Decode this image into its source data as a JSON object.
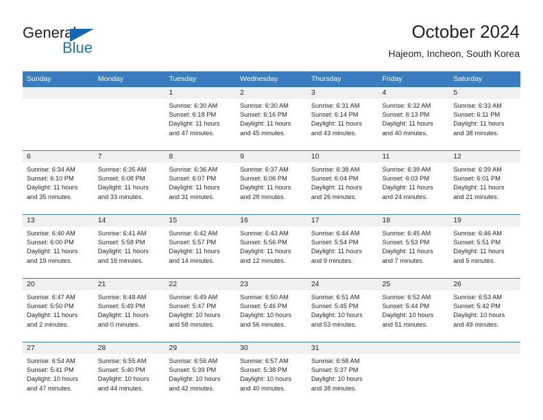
{
  "brand": {
    "name_primary": "General",
    "name_secondary": "Blue",
    "triangle_color": "#1268b3",
    "secondary_color": "#1b75bc"
  },
  "header": {
    "title": "October 2024",
    "subtitle": "Hajeom, Incheon, South Korea"
  },
  "theme": {
    "header_blue": "#3a7cc0",
    "daynum_band": "#f0f0f0",
    "text": "#231f20"
  },
  "weekdays": [
    "Sunday",
    "Monday",
    "Tuesday",
    "Wednesday",
    "Thursday",
    "Friday",
    "Saturday"
  ],
  "weeks": [
    [
      {
        "day": "",
        "sunrise": "",
        "sunset": "",
        "daylight_line1": "",
        "daylight_line2": "",
        "empty": true
      },
      {
        "day": "",
        "sunrise": "",
        "sunset": "",
        "daylight_line1": "",
        "daylight_line2": "",
        "empty": true
      },
      {
        "day": "1",
        "sunrise": "Sunrise: 6:30 AM",
        "sunset": "Sunset: 6:18 PM",
        "daylight_line1": "Daylight: 11 hours",
        "daylight_line2": "and 47 minutes."
      },
      {
        "day": "2",
        "sunrise": "Sunrise: 6:30 AM",
        "sunset": "Sunset: 6:16 PM",
        "daylight_line1": "Daylight: 11 hours",
        "daylight_line2": "and 45 minutes."
      },
      {
        "day": "3",
        "sunrise": "Sunrise: 6:31 AM",
        "sunset": "Sunset: 6:14 PM",
        "daylight_line1": "Daylight: 11 hours",
        "daylight_line2": "and 43 minutes."
      },
      {
        "day": "4",
        "sunrise": "Sunrise: 6:32 AM",
        "sunset": "Sunset: 6:13 PM",
        "daylight_line1": "Daylight: 11 hours",
        "daylight_line2": "and 40 minutes."
      },
      {
        "day": "5",
        "sunrise": "Sunrise: 6:33 AM",
        "sunset": "Sunset: 6:11 PM",
        "daylight_line1": "Daylight: 11 hours",
        "daylight_line2": "and 38 minutes."
      }
    ],
    [
      {
        "day": "6",
        "sunrise": "Sunrise: 6:34 AM",
        "sunset": "Sunset: 6:10 PM",
        "daylight_line1": "Daylight: 11 hours",
        "daylight_line2": "and 35 minutes."
      },
      {
        "day": "7",
        "sunrise": "Sunrise: 6:35 AM",
        "sunset": "Sunset: 6:08 PM",
        "daylight_line1": "Daylight: 11 hours",
        "daylight_line2": "and 33 minutes."
      },
      {
        "day": "8",
        "sunrise": "Sunrise: 6:36 AM",
        "sunset": "Sunset: 6:07 PM",
        "daylight_line1": "Daylight: 11 hours",
        "daylight_line2": "and 31 minutes."
      },
      {
        "day": "9",
        "sunrise": "Sunrise: 6:37 AM",
        "sunset": "Sunset: 6:06 PM",
        "daylight_line1": "Daylight: 11 hours",
        "daylight_line2": "and 28 minutes."
      },
      {
        "day": "10",
        "sunrise": "Sunrise: 6:38 AM",
        "sunset": "Sunset: 6:04 PM",
        "daylight_line1": "Daylight: 11 hours",
        "daylight_line2": "and 26 minutes."
      },
      {
        "day": "11",
        "sunrise": "Sunrise: 6:39 AM",
        "sunset": "Sunset: 6:03 PM",
        "daylight_line1": "Daylight: 11 hours",
        "daylight_line2": "and 24 minutes."
      },
      {
        "day": "12",
        "sunrise": "Sunrise: 6:39 AM",
        "sunset": "Sunset: 6:01 PM",
        "daylight_line1": "Daylight: 11 hours",
        "daylight_line2": "and 21 minutes."
      }
    ],
    [
      {
        "day": "13",
        "sunrise": "Sunrise: 6:40 AM",
        "sunset": "Sunset: 6:00 PM",
        "daylight_line1": "Daylight: 11 hours",
        "daylight_line2": "and 19 minutes."
      },
      {
        "day": "14",
        "sunrise": "Sunrise: 6:41 AM",
        "sunset": "Sunset: 5:58 PM",
        "daylight_line1": "Daylight: 11 hours",
        "daylight_line2": "and 16 minutes."
      },
      {
        "day": "15",
        "sunrise": "Sunrise: 6:42 AM",
        "sunset": "Sunset: 5:57 PM",
        "daylight_line1": "Daylight: 11 hours",
        "daylight_line2": "and 14 minutes."
      },
      {
        "day": "16",
        "sunrise": "Sunrise: 6:43 AM",
        "sunset": "Sunset: 5:56 PM",
        "daylight_line1": "Daylight: 11 hours",
        "daylight_line2": "and 12 minutes."
      },
      {
        "day": "17",
        "sunrise": "Sunrise: 6:44 AM",
        "sunset": "Sunset: 5:54 PM",
        "daylight_line1": "Daylight: 11 hours",
        "daylight_line2": "and 9 minutes."
      },
      {
        "day": "18",
        "sunrise": "Sunrise: 6:45 AM",
        "sunset": "Sunset: 5:53 PM",
        "daylight_line1": "Daylight: 11 hours",
        "daylight_line2": "and 7 minutes."
      },
      {
        "day": "19",
        "sunrise": "Sunrise: 6:46 AM",
        "sunset": "Sunset: 5:51 PM",
        "daylight_line1": "Daylight: 11 hours",
        "daylight_line2": "and 5 minutes."
      }
    ],
    [
      {
        "day": "20",
        "sunrise": "Sunrise: 6:47 AM",
        "sunset": "Sunset: 5:50 PM",
        "daylight_line1": "Daylight: 11 hours",
        "daylight_line2": "and 2 minutes."
      },
      {
        "day": "21",
        "sunrise": "Sunrise: 6:48 AM",
        "sunset": "Sunset: 5:49 PM",
        "daylight_line1": "Daylight: 11 hours",
        "daylight_line2": "and 0 minutes."
      },
      {
        "day": "22",
        "sunrise": "Sunrise: 6:49 AM",
        "sunset": "Sunset: 5:47 PM",
        "daylight_line1": "Daylight: 10 hours",
        "daylight_line2": "and 58 minutes."
      },
      {
        "day": "23",
        "sunrise": "Sunrise: 6:50 AM",
        "sunset": "Sunset: 5:46 PM",
        "daylight_line1": "Daylight: 10 hours",
        "daylight_line2": "and 56 minutes."
      },
      {
        "day": "24",
        "sunrise": "Sunrise: 6:51 AM",
        "sunset": "Sunset: 5:45 PM",
        "daylight_line1": "Daylight: 10 hours",
        "daylight_line2": "and 53 minutes."
      },
      {
        "day": "25",
        "sunrise": "Sunrise: 6:52 AM",
        "sunset": "Sunset: 5:44 PM",
        "daylight_line1": "Daylight: 10 hours",
        "daylight_line2": "and 51 minutes."
      },
      {
        "day": "26",
        "sunrise": "Sunrise: 6:53 AM",
        "sunset": "Sunset: 5:42 PM",
        "daylight_line1": "Daylight: 10 hours",
        "daylight_line2": "and 49 minutes."
      }
    ],
    [
      {
        "day": "27",
        "sunrise": "Sunrise: 6:54 AM",
        "sunset": "Sunset: 5:41 PM",
        "daylight_line1": "Daylight: 10 hours",
        "daylight_line2": "and 47 minutes."
      },
      {
        "day": "28",
        "sunrise": "Sunrise: 6:55 AM",
        "sunset": "Sunset: 5:40 PM",
        "daylight_line1": "Daylight: 10 hours",
        "daylight_line2": "and 44 minutes."
      },
      {
        "day": "29",
        "sunrise": "Sunrise: 6:56 AM",
        "sunset": "Sunset: 5:39 PM",
        "daylight_line1": "Daylight: 10 hours",
        "daylight_line2": "and 42 minutes."
      },
      {
        "day": "30",
        "sunrise": "Sunrise: 6:57 AM",
        "sunset": "Sunset: 5:38 PM",
        "daylight_line1": "Daylight: 10 hours",
        "daylight_line2": "and 40 minutes."
      },
      {
        "day": "31",
        "sunrise": "Sunrise: 6:58 AM",
        "sunset": "Sunset: 5:37 PM",
        "daylight_line1": "Daylight: 10 hours",
        "daylight_line2": "and 38 minutes."
      },
      {
        "day": "",
        "sunrise": "",
        "sunset": "",
        "daylight_line1": "",
        "daylight_line2": "",
        "empty": true
      },
      {
        "day": "",
        "sunrise": "",
        "sunset": "",
        "daylight_line1": "",
        "daylight_line2": "",
        "empty": true
      }
    ]
  ]
}
